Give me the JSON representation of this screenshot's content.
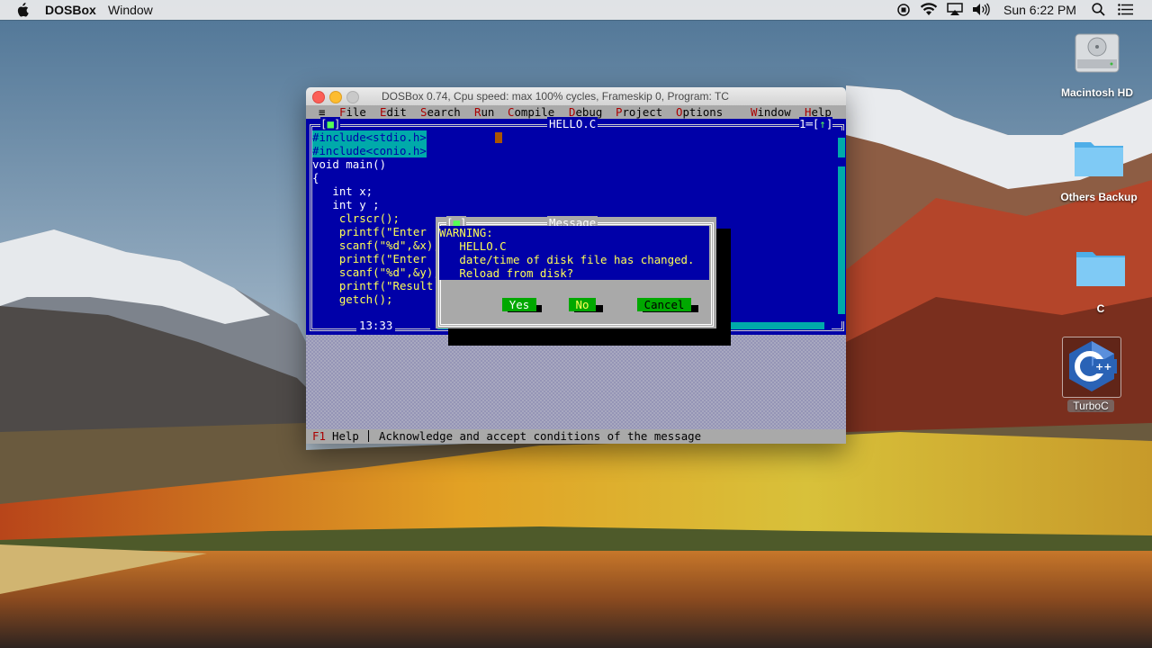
{
  "menubar": {
    "app_name": "DOSBox",
    "items": [
      "Window"
    ],
    "clock": "Sun 6:22 PM"
  },
  "desktop": {
    "icons": [
      {
        "label": "Macintosh HD"
      },
      {
        "label": "Others Backup"
      },
      {
        "label": "C"
      },
      {
        "label": "TurboC"
      }
    ]
  },
  "dosbox": {
    "title": "DOSBox 0.74, Cpu speed: max 100% cycles, Frameskip  0, Program:     TC",
    "tc_menu": {
      "items": [
        "File",
        "Edit",
        "Search",
        "Run",
        "Compile",
        "Debug",
        "Project",
        "Options",
        "Window",
        "Help"
      ]
    },
    "editor": {
      "filename": "HELLO.C",
      "window_number": "1",
      "cursor_pos": "13:33",
      "code": [
        "#include<stdio.h>",
        "#include<conio.h>",
        "void main()",
        "{",
        "   int x;",
        "   int y ;",
        "    clrscr();",
        "    printf(\"Enter",
        "    scanf(\"%d\",&x);",
        "    printf(\"Enter",
        "    scanf(\"%d\",&y);",
        "    printf(\"Result",
        "    getch();"
      ]
    },
    "dialog": {
      "title": "Message",
      "lines": [
        "WARNING:",
        "   HELLO.C",
        "   date/time of disk file has changed.",
        "   Reload from disk?"
      ],
      "yes": "Yes",
      "no": "No",
      "cancel": "Cancel"
    },
    "status": {
      "key": "F1",
      "key_label": "Help",
      "message": "Acknowledge and accept conditions of the message"
    }
  },
  "colors": {
    "dos_blue": "#0000a8",
    "dos_gray": "#a9a9a9",
    "dos_green": "#00a800",
    "dos_red": "#aa0000"
  }
}
